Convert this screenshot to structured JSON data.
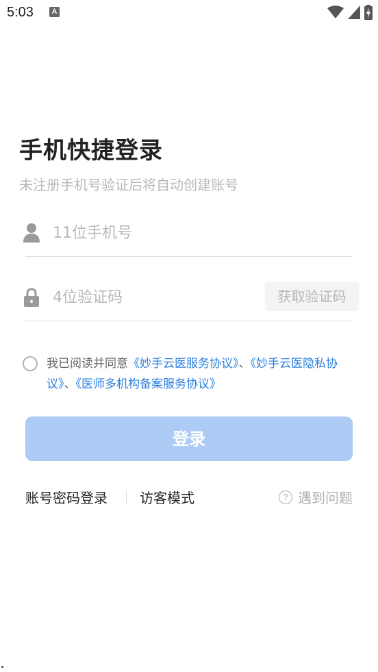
{
  "status_bar": {
    "time": "5:03",
    "notification_icon": "A"
  },
  "title": "手机快捷登录",
  "subtitle": "未注册手机号验证后将自动创建账号",
  "phone": {
    "icon": "user-icon",
    "placeholder": "11位手机号",
    "value": ""
  },
  "code": {
    "icon": "lock-icon",
    "placeholder": "4位验证码",
    "value": "",
    "get_code_label": "获取验证码"
  },
  "agreement": {
    "checked": false,
    "prefix": "我已阅读并同意",
    "link_service": "《妙手云医服务协议》",
    "sep1": "、",
    "link_privacy": "《妙手云医隐私协议》",
    "sep2": "、",
    "link_filing": "《医师多机构备案服务协议》"
  },
  "login_label": "登录",
  "bottom": {
    "password_login": "账号密码登录",
    "guest_mode": "访客模式",
    "help_icon_glyph": "?",
    "help": "遇到问题"
  },
  "colors": {
    "accent": "#2a7fe0",
    "login_button_disabled": "#aecbf5",
    "placeholder": "#b8b8b8"
  }
}
